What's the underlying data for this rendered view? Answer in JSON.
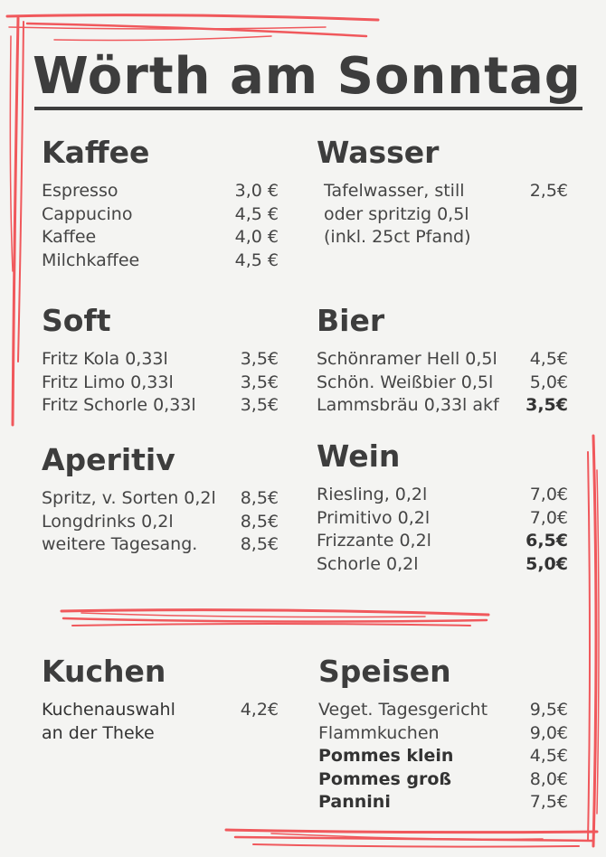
{
  "menu": {
    "title": "Wörth am Sonntag",
    "kaffee": {
      "heading": "Kaffee",
      "items": [
        {
          "name": "Espresso",
          "price": "3,0 €"
        },
        {
          "name": "Cappucino",
          "price": "4,5 €"
        },
        {
          "name": "Kaffee",
          "price": "4,0 €"
        },
        {
          "name": "Milchkaffee",
          "price": "4,5 €"
        }
      ]
    },
    "wasser": {
      "heading": "Wasser",
      "lines": [
        "Tafelwasser, still",
        "oder spritzig 0,5l",
        "(inkl. 25ct Pfand)"
      ],
      "price": "2,5€"
    },
    "soft": {
      "heading": "Soft",
      "items": [
        {
          "name": "Fritz Kola 0,33l",
          "price": "3,5€"
        },
        {
          "name": "Fritz Limo 0,33l",
          "price": "3,5€"
        },
        {
          "name": "Fritz Schorle 0,33l",
          "price": "3,5€"
        }
      ]
    },
    "bier": {
      "heading": "Bier",
      "items": [
        {
          "name": "Schönramer Hell 0,5l",
          "price": "4,5€"
        },
        {
          "name": "Schön. Weißbier 0,5l",
          "price": "5,0€"
        },
        {
          "name": "Lammsbräu 0,33l akf",
          "price": "3,5€"
        }
      ]
    },
    "aperitiv": {
      "heading": "Aperitiv",
      "items": [
        {
          "name": "Spritz, v. Sorten 0,2l",
          "price": "8,5€"
        },
        {
          "name": "Longdrinks 0,2l",
          "price": "8,5€"
        },
        {
          "name": "weitere Tagesang.",
          "price": "8,5€"
        }
      ]
    },
    "wein": {
      "heading": "Wein",
      "items": [
        {
          "name": "Riesling, 0,2l",
          "price": "7,0€"
        },
        {
          "name": "Primitivo 0,2l",
          "price": "7,0€"
        },
        {
          "name": "Frizzante 0,2l",
          "price": "6,5€"
        },
        {
          "name": "Schorle 0,2l",
          "price": "5,0€"
        }
      ]
    },
    "kuchen": {
      "heading": "Kuchen",
      "lines": [
        "Kuchenauswahl",
        "an der Theke"
      ],
      "price": "4,2€"
    },
    "speisen": {
      "heading": "Speisen",
      "items": [
        {
          "name": "Veget. Tagesgericht",
          "price": "9,5€"
        },
        {
          "name": "Flammkuchen",
          "price": "9,0€"
        },
        {
          "name": "Pommes klein",
          "price": "4,5€"
        },
        {
          "name": "Pommes groß",
          "price": "8,0€"
        },
        {
          "name": "Pannini",
          "price": "7,5€"
        }
      ]
    }
  },
  "colors": {
    "accent": "#f0585c",
    "text": "#3d3d3d",
    "background": "#f4f4f2"
  }
}
